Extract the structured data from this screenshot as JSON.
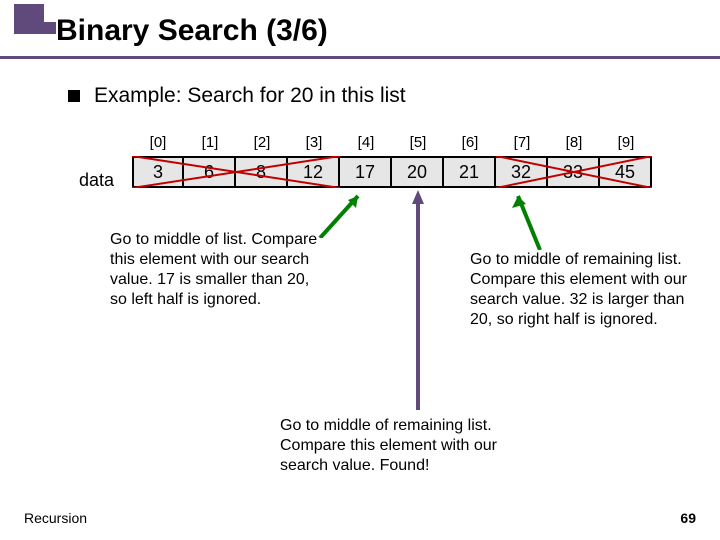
{
  "title": "Binary Search (3/6)",
  "subtitle": "Example: Search for 20 in this list",
  "data_label": "data",
  "array": {
    "indices": [
      "[0]",
      "[1]",
      "[2]",
      "[3]",
      "[4]",
      "[5]",
      "[6]",
      "[7]",
      "[8]",
      "[9]"
    ],
    "values": [
      "3",
      "6",
      "8",
      "12",
      "17",
      "20",
      "21",
      "32",
      "33",
      "45"
    ]
  },
  "notes": {
    "left": "Go to middle of list. Compare this element with our search value. 17 is smaller than 20, so left half is ignored.",
    "right": "Go to middle of remaining list. Compare this element with our search value. 32 is larger than 20, so right half is ignored.",
    "bottom": "Go to middle of remaining list. Compare this element with our search value. Found!"
  },
  "colors": {
    "accent": "#604a7b",
    "cross": "#c00000",
    "arrow_green": "#008000",
    "arrow_purple": "#604a7b"
  },
  "footer": {
    "left": "Recursion",
    "right": "69"
  }
}
